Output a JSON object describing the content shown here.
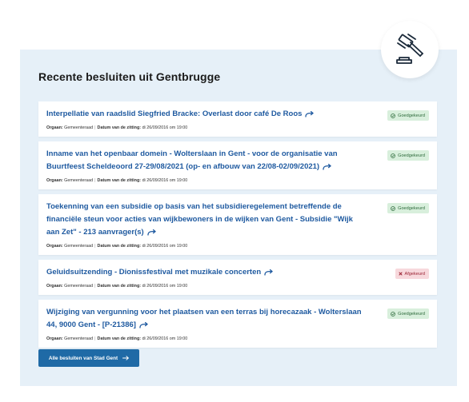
{
  "section": {
    "heading": "Recente besluiten uit Gentbrugge",
    "icon": "gavel-icon"
  },
  "labels": {
    "organ": "Orgaan:",
    "date": "Datum van de zitting:"
  },
  "decisions": [
    {
      "title": "Interpellatie van raadslid Siegfried Bracke: Overlast door café De Roos",
      "organ": "Gemeenteraad",
      "date": "di 26/09/2016 om 19:00",
      "status": "Goedgekeurd",
      "status_type": "approved"
    },
    {
      "title": "Inname van het openbaar domein - Wolterslaan in Gent - voor de organisatie van Buurtfeest Scheldeoord 27-29/08/2021 (op- en afbouw van 22/08-02/09/2021)",
      "organ": "Gemeenteraad",
      "date": "di 26/09/2016 om 19:00",
      "status": "Goedgekeurd",
      "status_type": "approved"
    },
    {
      "title": "Toekenning van een subsidie op basis van het subsidieregelement betreffende de financiële steun voor acties van wijkbewoners in de wijken van Gent - Subsidie \"Wijk aan Zet\" - 213 aanvrager(s)",
      "organ": "Gemeenteraad",
      "date": "di 26/09/2016 om 19:00",
      "status": "Goedgekeurd",
      "status_type": "approved"
    },
    {
      "title": "Geluidsuitzending - Dionissfestival met muzikale concerten",
      "organ": "Gemeenteraad",
      "date": "di 26/09/2016 om 19:00",
      "status": "Afgekeurd",
      "status_type": "rejected"
    },
    {
      "title": "Wijziging van vergunning voor het plaatsen van een terras bij horecazaak - Wolterslaan 44, 9000 Gent - [P-21386]",
      "organ": "Gemeenteraad",
      "date": "di 26/09/2016 om 19:00",
      "status": "Goedgekeurd",
      "status_type": "approved"
    }
  ],
  "cta": {
    "label": "Alle besluiten van Stad Gent",
    "icon": "arrow-right-icon"
  },
  "colors": {
    "panel_bg": "#e6f0f8",
    "link": "#1f5aa0",
    "approved_bg": "#d8efdc",
    "rejected_bg": "#f7d8dc",
    "button_bg": "#1f6aa6"
  }
}
